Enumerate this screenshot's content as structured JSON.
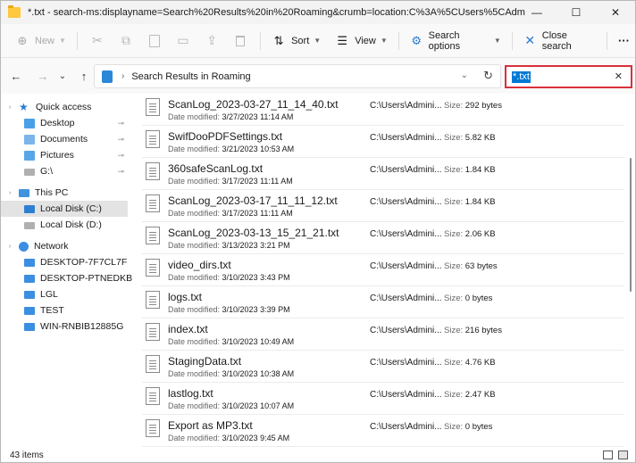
{
  "window": {
    "title": "*.txt - search-ms:displayname=Search%20Results%20in%20Roaming&crumb=location:C%3A%5CUsers%5CAdm",
    "controls": {
      "minimize": "—",
      "maximize": "☐",
      "close": "✕"
    }
  },
  "toolbar": {
    "new_label": "New",
    "sort_label": "Sort",
    "view_label": "View",
    "search_options_label": "Search options",
    "close_search_label": "Close search",
    "more_label": "···",
    "icons": {
      "new": "⊕",
      "cut": "✂",
      "copy": "⧉",
      "paste": "📋",
      "rename": "▭",
      "share": "⇪",
      "delete": "🗑",
      "sort": "⇅",
      "view": "☰",
      "search_options": "⚙",
      "close_search": "✕"
    }
  },
  "nav": {
    "back": "←",
    "forward": "→",
    "recent": "⌄",
    "up": "↑",
    "address_separator": "›",
    "address_text": "Search Results in Roaming",
    "address_chevron": "⌄",
    "refresh": "↻",
    "search_value": "*.txt",
    "search_clear": "✕"
  },
  "sidebar": {
    "items": [
      {
        "label": "Quick access",
        "pinned": false
      },
      {
        "label": "Desktop",
        "pinned": true
      },
      {
        "label": "Documents",
        "pinned": true
      },
      {
        "label": "Pictures",
        "pinned": true
      },
      {
        "label": "G:\\",
        "pinned": true
      },
      {
        "label": "This PC",
        "pinned": false
      },
      {
        "label": "Local Disk (C:)",
        "pinned": false,
        "selected": true
      },
      {
        "label": "Local Disk (D:)",
        "pinned": false
      },
      {
        "label": "Network",
        "pinned": false
      },
      {
        "label": "DESKTOP-7F7CL7F",
        "pinned": false
      },
      {
        "label": "DESKTOP-PTNEDKB",
        "pinned": false
      },
      {
        "label": "LGL",
        "pinned": false
      },
      {
        "label": "TEST",
        "pinned": false
      },
      {
        "label": "WIN-RNBIB12885G",
        "pinned": false
      }
    ],
    "pin_glyph": "📌",
    "expand_glyph": "›"
  },
  "files": {
    "date_prefix": "Date modified: ",
    "size_prefix": "Size: ",
    "rows": [
      {
        "name": "ScanLog_2023-03-27_11_14_40.txt",
        "date": "3/27/2023 11:14 AM",
        "path": "C:\\Users\\Admini...",
        "size": "292 bytes"
      },
      {
        "name": "SwifDooPDFSettings.txt",
        "date": "3/21/2023 10:53 AM",
        "path": "C:\\Users\\Admini...",
        "size": "5.82 KB"
      },
      {
        "name": "360safeScanLog.txt",
        "date": "3/17/2023 11:11 AM",
        "path": "C:\\Users\\Admini...",
        "size": "1.84 KB"
      },
      {
        "name": "ScanLog_2023-03-17_11_11_12.txt",
        "date": "3/17/2023 11:11 AM",
        "path": "C:\\Users\\Admini...",
        "size": "1.84 KB"
      },
      {
        "name": "ScanLog_2023-03-13_15_21_21.txt",
        "date": "3/13/2023 3:21 PM",
        "path": "C:\\Users\\Admini...",
        "size": "2.06 KB"
      },
      {
        "name": "video_dirs.txt",
        "date": "3/10/2023 3:43 PM",
        "path": "C:\\Users\\Admini...",
        "size": "63 bytes"
      },
      {
        "name": "logs.txt",
        "date": "3/10/2023 3:39 PM",
        "path": "C:\\Users\\Admini...",
        "size": "0 bytes"
      },
      {
        "name": "index.txt",
        "date": "3/10/2023 10:49 AM",
        "path": "C:\\Users\\Admini...",
        "size": "216 bytes"
      },
      {
        "name": "StagingData.txt",
        "date": "3/10/2023 10:38 AM",
        "path": "C:\\Users\\Admini...",
        "size": "4.76 KB"
      },
      {
        "name": "lastlog.txt",
        "date": "3/10/2023 10:07 AM",
        "path": "C:\\Users\\Admini...",
        "size": "2.47 KB"
      },
      {
        "name": "Export as MP3.txt",
        "date": "3/10/2023 9:45 AM",
        "path": "C:\\Users\\Admini...",
        "size": "0 bytes"
      }
    ]
  },
  "status": {
    "item_count": "43 items"
  },
  "colors": {
    "search_highlight_border": "#d9303c",
    "selection_blue": "#0078d4",
    "folder_yellow": "#ffc83d"
  }
}
